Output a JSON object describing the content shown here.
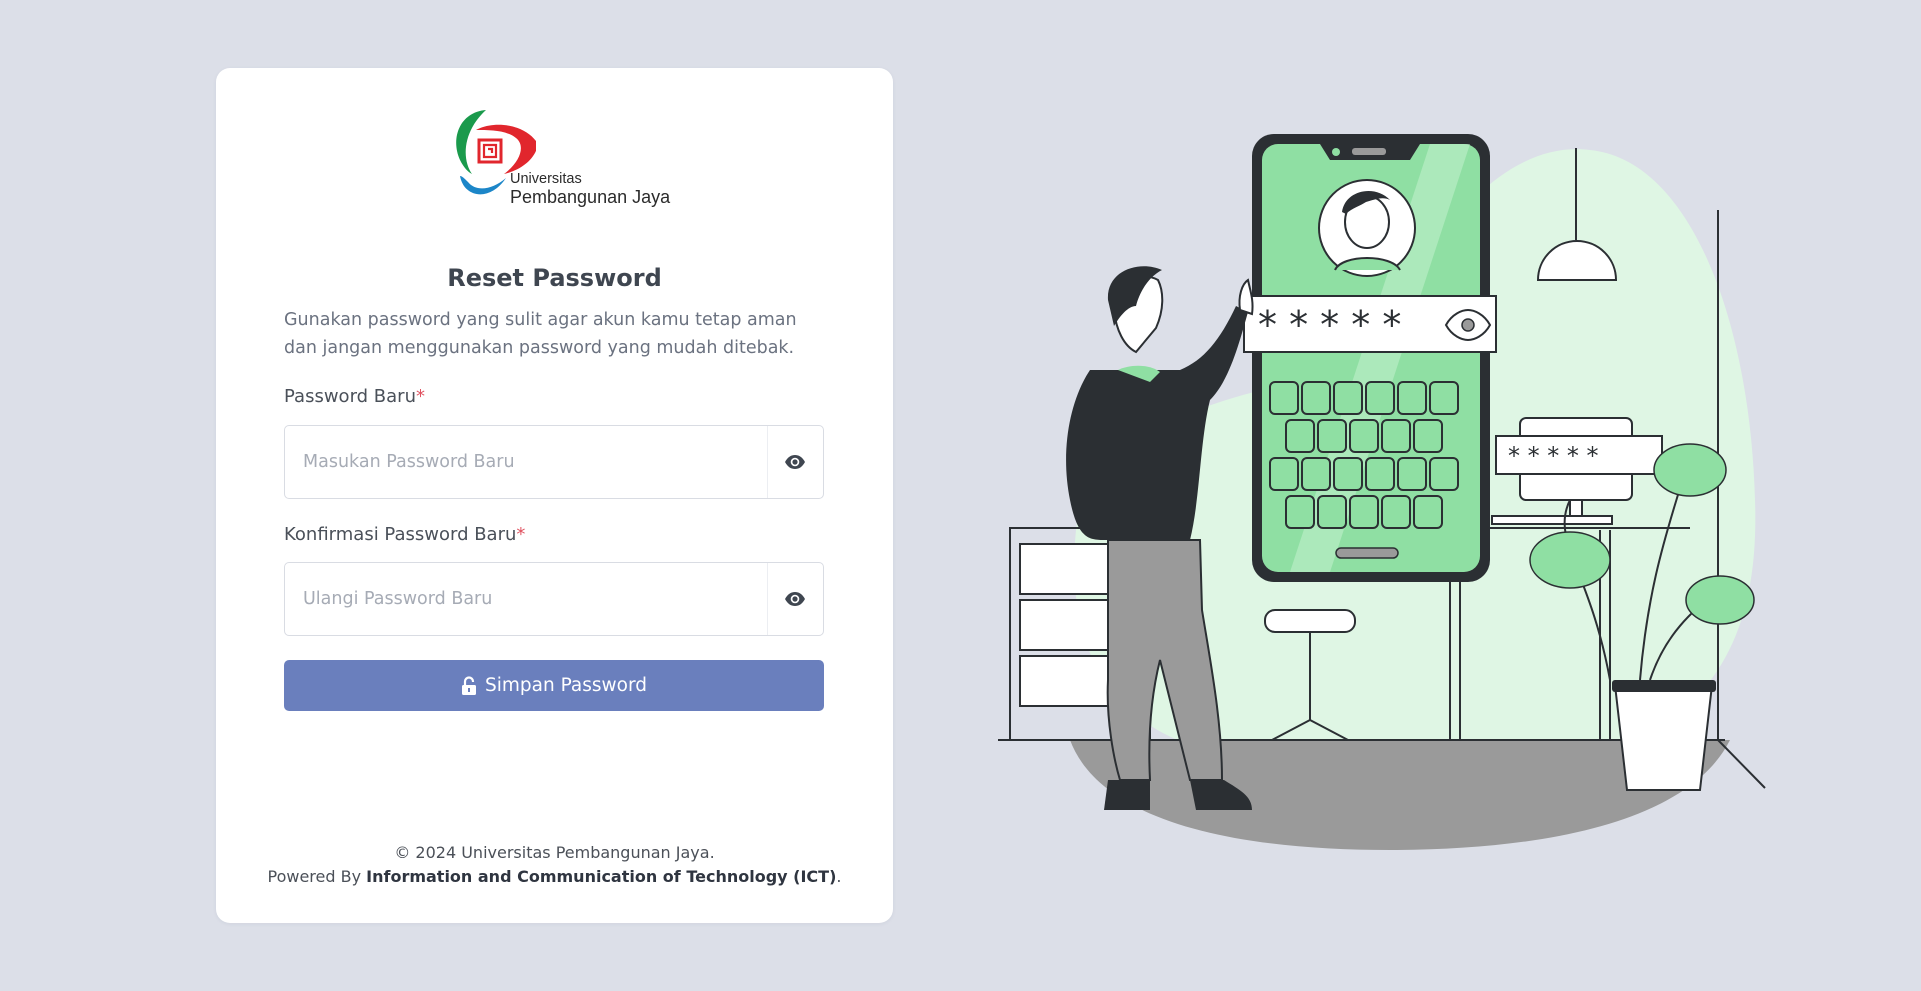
{
  "brand": {
    "logo_line1": "Universitas",
    "logo_line2": "Pembangunan Jaya",
    "colors": {
      "green": "#1a9a4c",
      "red": "#e1262d",
      "blue": "#1c86c8"
    }
  },
  "form": {
    "title": "Reset Password",
    "description": "Gunakan password yang sulit agar akun kamu tetap aman dan jangan menggunakan password yang mudah ditebak.",
    "new_password": {
      "label": "Password Baru",
      "required_mark": "*",
      "placeholder": "Masukan Password Baru",
      "value": "",
      "toggle_icon": "eye-icon"
    },
    "confirm_password": {
      "label": "Konfirmasi Password Baru",
      "required_mark": "*",
      "placeholder": "Ulangi Password Baru",
      "value": "",
      "toggle_icon": "eye-icon"
    },
    "submit": {
      "label": "Simpan Password",
      "icon": "unlock-icon",
      "color": "#6a7fbd"
    }
  },
  "footer": {
    "copyright": "© 2024 Universitas Pembangunan Jaya.",
    "powered_prefix": "Powered By ",
    "powered_by": "Information and Communication of Technology (ICT)",
    "powered_suffix": "."
  },
  "illustration": {
    "phone_mask": "* * * * *",
    "monitor_mask": "* * * * *",
    "accent_color": "#8fdfa3"
  }
}
